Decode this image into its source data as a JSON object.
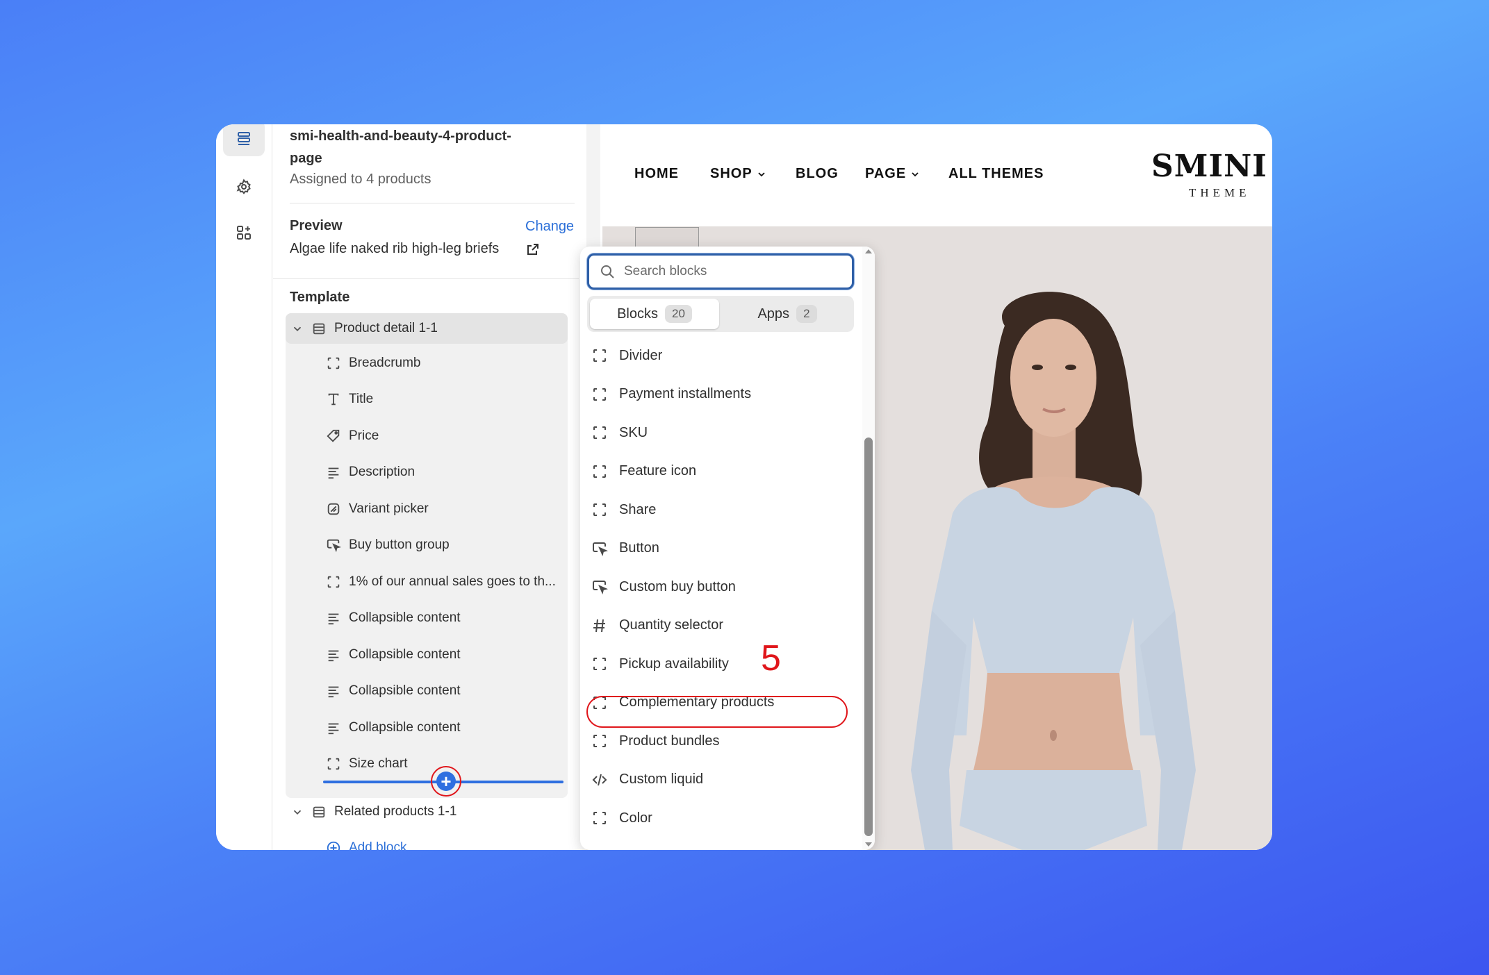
{
  "template": {
    "name": "smi-health-and-beauty-4-product-page",
    "name_line1": "smi-health-and-beauty-4-product-",
    "name_line2": "page",
    "assigned": "Assigned to 4 products"
  },
  "preview": {
    "label": "Preview",
    "change": "Change",
    "product": "Algae life naked rib high-leg briefs"
  },
  "tree": {
    "heading": "Template",
    "section1": "Product detail 1-1",
    "items": [
      {
        "label": "Breadcrumb",
        "icon": "block-icon"
      },
      {
        "label": "Title",
        "icon": "text-icon"
      },
      {
        "label": "Price",
        "icon": "price-tag-icon"
      },
      {
        "label": "Description",
        "icon": "paragraph-icon"
      },
      {
        "label": "Variant picker",
        "icon": "variant-icon"
      },
      {
        "label": "Buy button group",
        "icon": "cursor-click-icon"
      },
      {
        "label": "1% of our annual sales goes to th...",
        "icon": "block-icon"
      },
      {
        "label": "Collapsible content",
        "icon": "paragraph-icon"
      },
      {
        "label": "Collapsible content",
        "icon": "paragraph-icon"
      },
      {
        "label": "Collapsible content",
        "icon": "paragraph-icon"
      },
      {
        "label": "Collapsible content",
        "icon": "paragraph-icon"
      },
      {
        "label": "Size chart",
        "icon": "block-icon"
      }
    ],
    "section2": "Related products 1-1",
    "add_block": "Add block"
  },
  "store": {
    "nav": [
      "HOME",
      "SHOP",
      "BLOG",
      "PAGE",
      "ALL THEMES"
    ],
    "logo": "SMINI",
    "logo_sub": "THEME"
  },
  "picker": {
    "search_placeholder": "Search blocks",
    "tabs": [
      {
        "label": "Blocks",
        "count": "20"
      },
      {
        "label": "Apps",
        "count": "2"
      }
    ],
    "blocks": [
      {
        "label": "Divider",
        "icon": "block-icon"
      },
      {
        "label": "Payment installments",
        "icon": "block-icon"
      },
      {
        "label": "SKU",
        "icon": "block-icon"
      },
      {
        "label": "Feature icon",
        "icon": "block-icon"
      },
      {
        "label": "Share",
        "icon": "block-icon"
      },
      {
        "label": "Button",
        "icon": "cursor-click-icon"
      },
      {
        "label": "Custom buy button",
        "icon": "cursor-click-icon"
      },
      {
        "label": "Quantity selector",
        "icon": "hash-icon"
      },
      {
        "label": "Pickup availability",
        "icon": "block-icon"
      },
      {
        "label": "Complementary products",
        "icon": "block-icon"
      },
      {
        "label": "Product bundles",
        "icon": "block-icon"
      },
      {
        "label": "Custom liquid",
        "icon": "code-icon"
      },
      {
        "label": "Color",
        "icon": "block-icon"
      }
    ],
    "step_number": "5"
  },
  "colors": {
    "accent": "#2b6fd8",
    "highlight": "#e0161b"
  }
}
